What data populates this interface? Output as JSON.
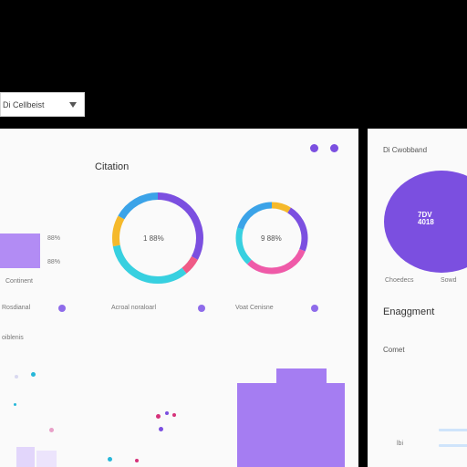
{
  "dropdown": {
    "value": "Di Cellbeist"
  },
  "main_panel": {
    "title": "Citation",
    "left_widget": {
      "pct_top": "88%",
      "pct_bottom": "88%",
      "label": "Continent"
    },
    "donut_1": {
      "center_label": "1 88%",
      "caption": "Acroal noraloarl",
      "segments": [
        "#7b4fe0",
        "#ef5a86",
        "#37d0e0",
        "#f5b92b",
        "#3ba3e8"
      ]
    },
    "donut_2": {
      "center_label": "9 88%",
      "caption": "Voat Cenisne",
      "segments": [
        "#7b4fe0",
        "#ef5aa8",
        "#37d0e0",
        "#3ba3e8",
        "#f5b92b"
      ]
    },
    "row_label_left": "Rosdianal",
    "section_label": "oiblenis",
    "colors": {
      "accent": "#a57df2",
      "dot_pink": "#d6327a",
      "dot_purple": "#7b4fe0",
      "dot_cyan": "#26b7d9"
    }
  },
  "side_panel": {
    "title": "Di Cwobband",
    "pie_label_line1": "7DV",
    "pie_label_line2": "4018",
    "legend_left": "Choedecs",
    "legend_right": "Sowd",
    "engagement_title": "Enaggment",
    "comment_label": "Comet",
    "footer_label": "lbi",
    "pie_color": "#7b4fe0"
  }
}
